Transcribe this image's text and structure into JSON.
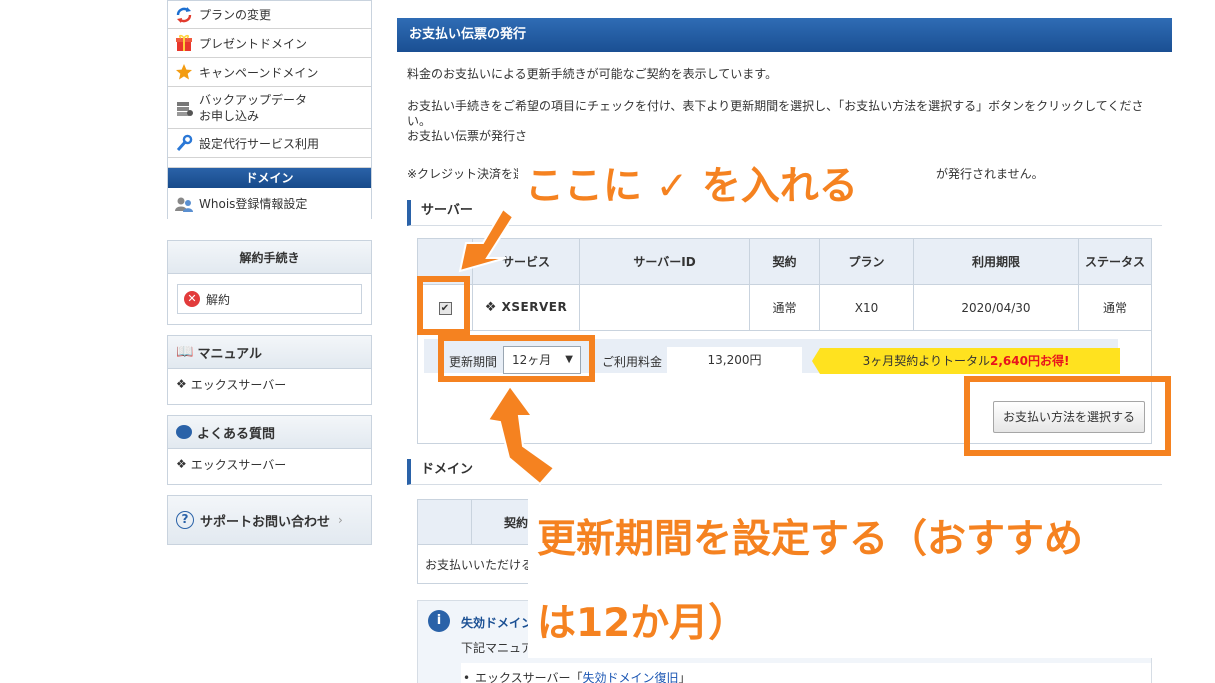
{
  "sidebar": {
    "contract_menu": [
      {
        "label": "プランの変更",
        "icon": "refresh-icon"
      },
      {
        "label": "プレゼントドメイン",
        "icon": "gift-icon"
      },
      {
        "label": "キャンペーンドメイン",
        "icon": "star-icon"
      },
      {
        "label": "バックアップデータ",
        "label2": "お申し込み",
        "icon": "server-icon"
      },
      {
        "label": "設定代行サービス利用",
        "icon": "wrench-icon"
      }
    ],
    "domain_header": "ドメイン",
    "domain_menu": [
      {
        "label": "Whois登録情報設定",
        "icon": "users-icon"
      }
    ],
    "cancel": {
      "title": "解約手続き",
      "item": "解約"
    },
    "manual": {
      "title": "マニュアル",
      "item": "エックスサーバー"
    },
    "faq": {
      "title": "よくある質問",
      "item": "エックスサーバー"
    },
    "support": {
      "title": "サポートお問い合わせ"
    }
  },
  "main": {
    "title": "お支払い伝票の発行",
    "p1": "料金のお支払いによる更新手続きが可能なご契約を表示しています。",
    "p2a": "お支払い手続きをご希望の項目にチェックを付け、表下より更新期間を選択し、「お支払い方法を選択する」ボタンをクリックしてくださ",
    "p2b": "い。",
    "p3": "お支払い伝票が発行さ",
    "p4a": "※クレジット決済を選",
    "p4b": "が発行されません。",
    "server_heading": "サーバー",
    "table": {
      "headers": [
        "サービス",
        "サーバーID",
        "契約",
        "プラン",
        "利用期限",
        "ステータス"
      ],
      "row": {
        "service": "XSERVER",
        "server_id": "",
        "contract": "通常",
        "plan": "X10",
        "expiry": "2020/04/30",
        "status": "通常"
      }
    },
    "renew_label": "更新期間",
    "renew_value": "12ヶ月",
    "fee_label": "ご利用料金",
    "fee_value": "13,200円",
    "promo_prefix": "3ヶ月契約よりトータル",
    "promo_amount": "2,640円お得!",
    "pay_button": "お支払い方法を選択する",
    "domain_heading": "ドメイン",
    "domain_table_header": "契約",
    "domain_text": "お支払いいただける",
    "info_title": "失効ドメイン",
    "info_text": "下記マニュア",
    "info_link_prefix": "エックスサーバー「",
    "info_link": "失効ドメイン復旧",
    "info_link_suffix": "」"
  },
  "annotations": {
    "check_note": "ここに ✓ を入れる",
    "period_note_line1": "更新期間を設定する（おすすめ",
    "period_note_line2": "は12か月）"
  },
  "colors": {
    "accent": "#f58220",
    "header_blue": "#1a4f93",
    "promo_yellow": "#ffe21f"
  }
}
